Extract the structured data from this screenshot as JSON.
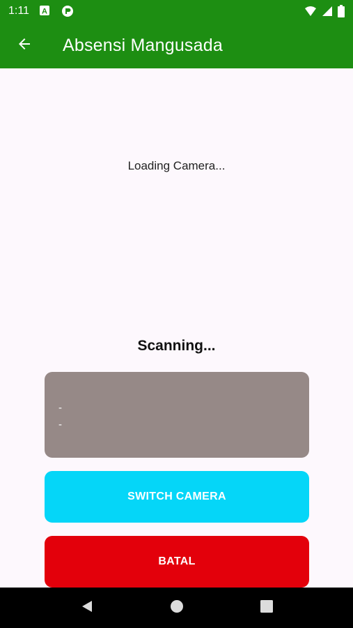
{
  "status_bar": {
    "time": "1:11",
    "icons": [
      "a-notification-icon",
      "app-notification-icon",
      "wifi-icon",
      "signal-icon",
      "battery-icon"
    ]
  },
  "app_bar": {
    "back_icon": "arrow-left-icon",
    "title": "Absensi Mangusada"
  },
  "camera": {
    "loading_text": "Loading Camera..."
  },
  "scan": {
    "status_text": "Scanning...",
    "result_lines": [
      "-",
      "-"
    ]
  },
  "buttons": {
    "switch_camera": "SWITCH CAMERA",
    "cancel": "BATAL"
  },
  "nav_bar": {
    "icons": [
      "back-triangle-icon",
      "home-circle-icon",
      "recents-square-icon"
    ]
  },
  "colors": {
    "primary": "#1d8e12",
    "result_box": "#968987",
    "switch_button": "#05d6f8",
    "cancel_button": "#e3000b",
    "background": "#fdf8fd"
  }
}
